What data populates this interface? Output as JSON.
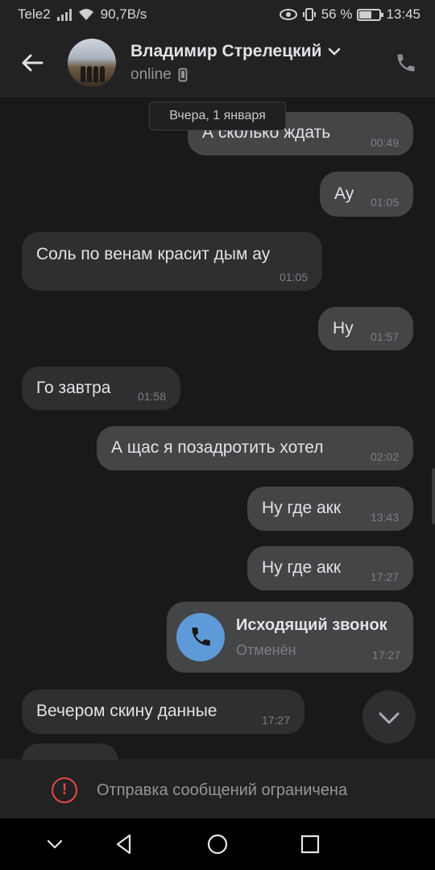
{
  "statusbar": {
    "carrier": "Tele2",
    "speed": "90,7B/s",
    "battery": "56 %",
    "time": "13:45"
  },
  "header": {
    "contact_name": "Владимир Стрелецкий",
    "status": "online"
  },
  "chat": {
    "date_separator": "Вчера, 1 января",
    "messages": [
      {
        "dir": "out",
        "text": "А сколько ждать",
        "time": "00:49"
      },
      {
        "dir": "out",
        "text": "Ау",
        "time": "01:05"
      },
      {
        "dir": "in",
        "text": "Соль по венам красит дым ау",
        "time": "01:05"
      },
      {
        "dir": "out",
        "text": "Ну",
        "time": "01:57"
      },
      {
        "dir": "in",
        "text": "Го завтра",
        "time": "01:58"
      },
      {
        "dir": "out",
        "text": "А щас я позадротить хотел",
        "time": "02:02"
      },
      {
        "dir": "out",
        "text": "Ну где акк",
        "time": "13:43"
      },
      {
        "dir": "out",
        "text": "Ну где акк",
        "time": "17:27"
      },
      {
        "dir": "in",
        "text": "Вечером скину данные",
        "time": "17:27"
      }
    ],
    "call": {
      "title": "Исходящий звонок",
      "subtitle": "Отменён",
      "time": "17:27"
    }
  },
  "restriction": {
    "text": "Отправка сообщений ограничена"
  },
  "colors": {
    "background": "#19191a",
    "outgoing_bubble": "#444547",
    "incoming_bubble": "#2e2f30",
    "accent_call": "#5e9ad8",
    "warning": "#e64646"
  },
  "icons": {
    "back": "arrow-left-icon",
    "phone": "phone-icon",
    "scroll_down": "chevron-down-icon",
    "warning": "exclamation-circle-icon"
  }
}
